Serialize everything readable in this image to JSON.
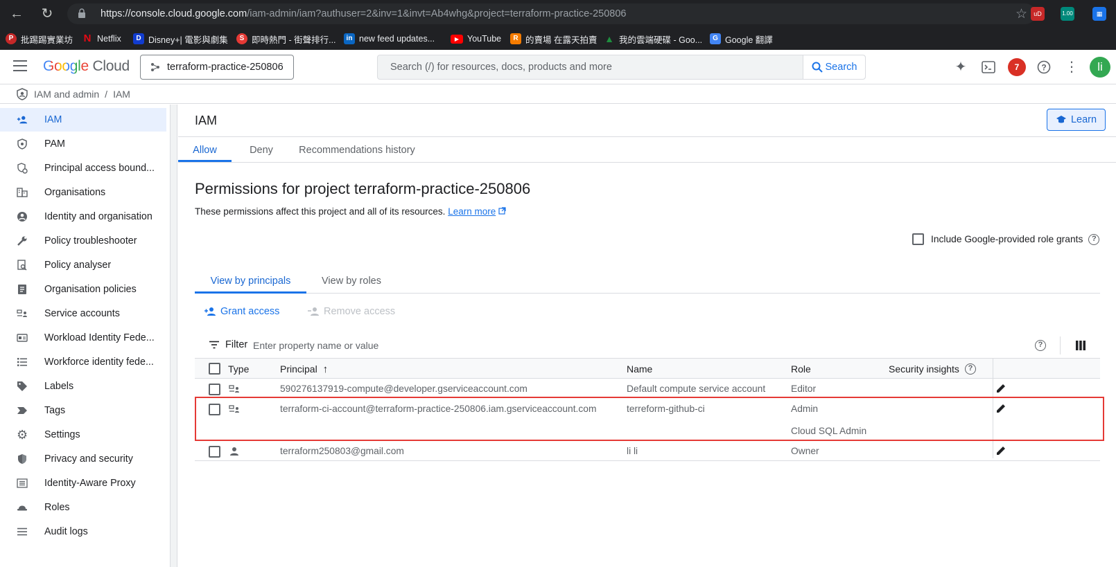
{
  "browser": {
    "url_domain": "https://console.cloud.google.com",
    "url_path": "/iam-admin/iam?authuser=2&inv=1&invt=Ab4whg&project=terraform-practice-250806",
    "ext_badge": "1.00",
    "bookmarks": [
      {
        "label": "批踢踢實業坊",
        "icon": "ptt-icon",
        "color": "#c62828"
      },
      {
        "label": "Netflix",
        "icon": "netflix-icon",
        "color": "#e50914"
      },
      {
        "label": "Disney+| 電影與劇集",
        "icon": "disney-icon",
        "color": "#113ccf"
      },
      {
        "label": "即時熱門 - 街聲排行...",
        "icon": "streetvoice-icon",
        "color": "#e53935"
      },
      {
        "label": "new feed updates...",
        "icon": "linkedin-icon",
        "color": "#0a66c2"
      },
      {
        "label": "YouTube",
        "icon": "youtube-icon",
        "color": "#ff0000"
      },
      {
        "label": "的賣場 在露天拍賣",
        "icon": "ruten-icon",
        "color": "#f57c00"
      },
      {
        "label": "我的雲端硬碟 - Goo...",
        "icon": "drive-icon",
        "color": "#1e8e3e"
      },
      {
        "label": "Google 翻譯",
        "icon": "translate-icon",
        "color": "#4285f4"
      }
    ]
  },
  "header": {
    "logo_google": "Google",
    "logo_cloud": "Cloud",
    "project": "terraform-practice-250806",
    "search_placeholder": "Search (/) for resources, docs, products and more",
    "search_button": "Search",
    "notifications": "7",
    "avatar": "li"
  },
  "breadcrumb": {
    "section": "IAM and admin",
    "separator": "/",
    "page": "IAM"
  },
  "sidebar": {
    "items": [
      {
        "label": "IAM",
        "icon": "person-add-icon",
        "active": true
      },
      {
        "label": "PAM",
        "icon": "shield-icon"
      },
      {
        "label": "Principal access bound...",
        "icon": "boundary-icon"
      },
      {
        "label": "Organisations",
        "icon": "building-icon"
      },
      {
        "label": "Identity and organisation",
        "icon": "account-circle-icon"
      },
      {
        "label": "Policy troubleshooter",
        "icon": "wrench-icon"
      },
      {
        "label": "Policy analyser",
        "icon": "doc-search-icon"
      },
      {
        "label": "Organisation policies",
        "icon": "list-doc-icon"
      },
      {
        "label": "Service accounts",
        "icon": "service-account-icon"
      },
      {
        "label": "Workload Identity Fede...",
        "icon": "id-card-icon"
      },
      {
        "label": "Workforce identity fede...",
        "icon": "list-icon"
      },
      {
        "label": "Labels",
        "icon": "label-icon"
      },
      {
        "label": "Tags",
        "icon": "tag-icon"
      },
      {
        "label": "Settings",
        "icon": "gear-icon"
      },
      {
        "label": "Privacy and security",
        "icon": "privacy-shield-icon"
      },
      {
        "label": "Identity-Aware Proxy",
        "icon": "proxy-icon"
      },
      {
        "label": "Roles",
        "icon": "hat-icon"
      },
      {
        "label": "Audit logs",
        "icon": "lines-icon"
      }
    ]
  },
  "main": {
    "title": "IAM",
    "learn_button": "Learn",
    "tabs": [
      {
        "label": "Allow",
        "active": true
      },
      {
        "label": "Deny"
      },
      {
        "label": "Recommendations history"
      }
    ],
    "permissions_title": "Permissions for project terraform-practice-250806",
    "permissions_desc": "These permissions affect this project and all of its resources.",
    "learn_more": "Learn more",
    "include_google_grants": "Include Google-provided role grants",
    "view_tabs": [
      {
        "label": "View by principals",
        "active": true
      },
      {
        "label": "View by roles"
      }
    ],
    "grant_access": "Grant access",
    "remove_access": "Remove access",
    "filter_label": "Filter",
    "filter_placeholder": "Enter property name or value"
  },
  "table": {
    "headers": {
      "type": "Type",
      "principal": "Principal",
      "name": "Name",
      "role": "Role",
      "security": "Security insights"
    },
    "rows": [
      {
        "type": "service-account",
        "principal": "590276137919-compute@developer.gserviceaccount.com",
        "name": "Default compute service account",
        "roles": [
          "Editor"
        ]
      },
      {
        "type": "service-account",
        "principal": "terraform-ci-account@terraform-practice-250806.iam.gserviceaccount.com",
        "name": "terreform-github-ci",
        "roles": [
          "Admin",
          "Cloud SQL Admin"
        ]
      },
      {
        "type": "user",
        "principal": "terraform250803@gmail.com",
        "name": "li li",
        "roles": [
          "Owner"
        ]
      }
    ]
  }
}
